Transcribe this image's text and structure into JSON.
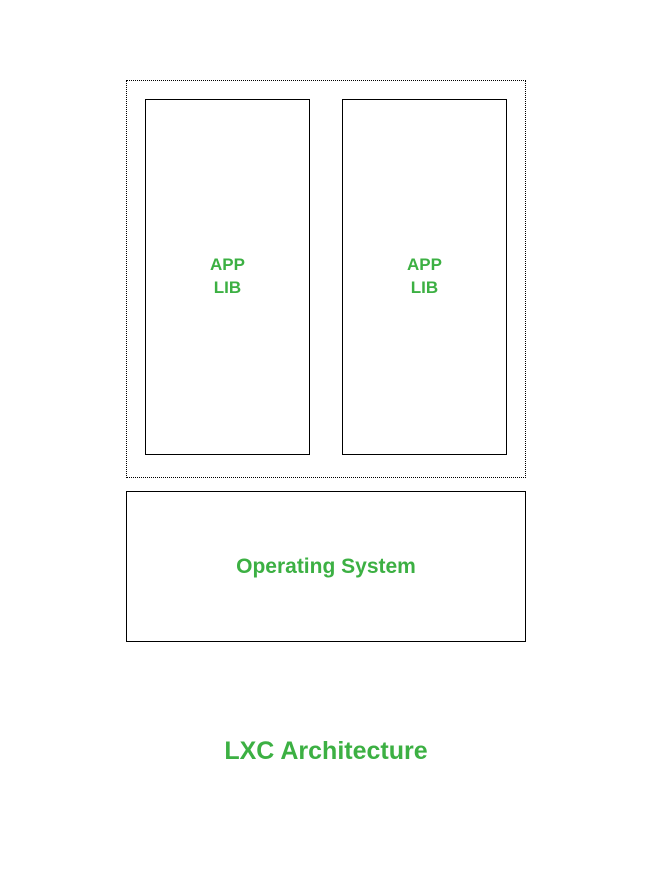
{
  "containers": [
    {
      "line1": "APP",
      "line2": "LIB"
    },
    {
      "line1": "APP",
      "line2": "LIB"
    }
  ],
  "os": {
    "label": "Operating System"
  },
  "title": "LXC Architecture",
  "colors": {
    "accent": "#3cb043"
  }
}
